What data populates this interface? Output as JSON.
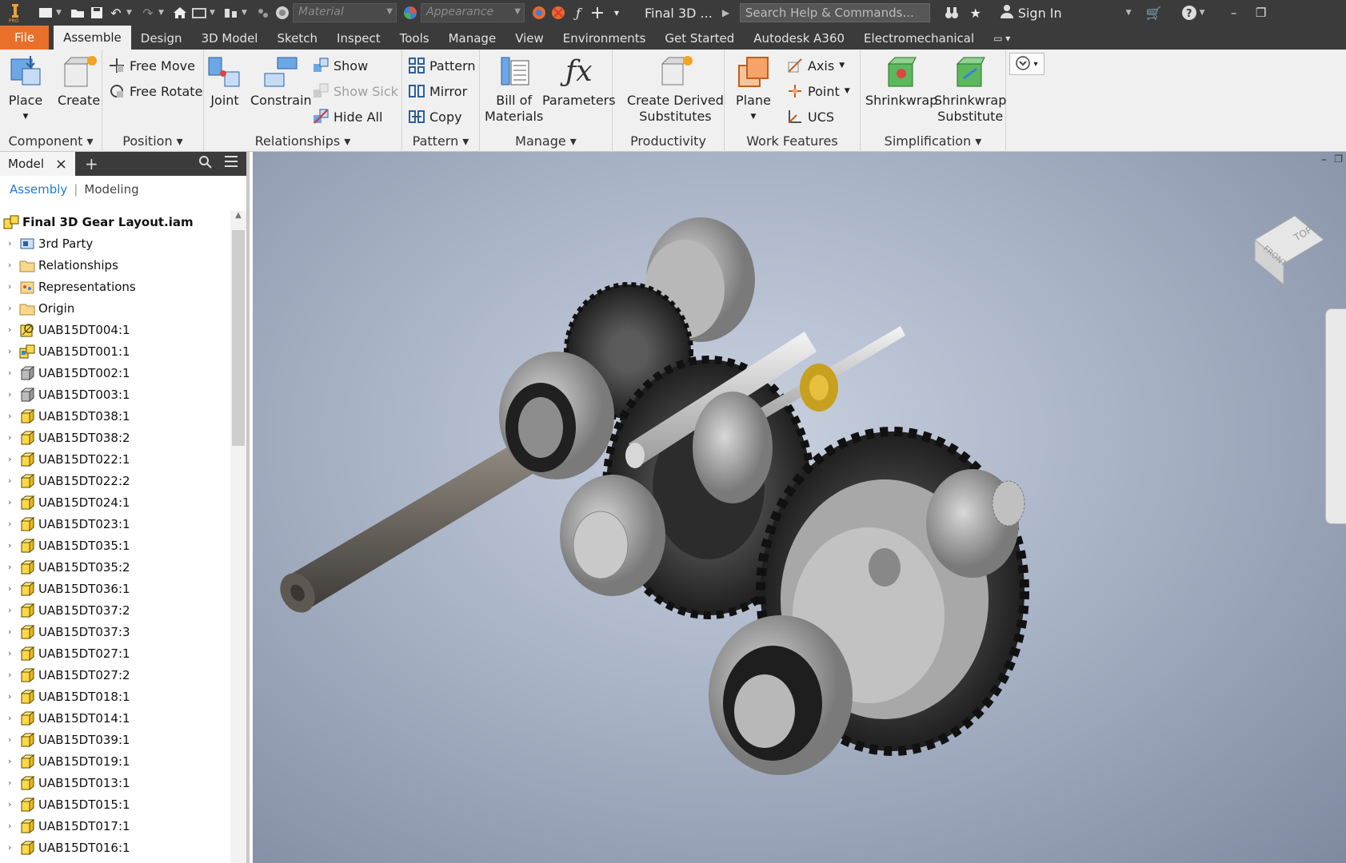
{
  "titlebar": {
    "material_placeholder": "Material",
    "appearance_placeholder": "Appearance",
    "doc_title": "Final 3D ...",
    "search_placeholder": "Search Help & Commands...",
    "sign_in": "Sign In"
  },
  "tabs": {
    "file": "File",
    "items": [
      "Assemble",
      "Design",
      "3D Model",
      "Sketch",
      "Inspect",
      "Tools",
      "Manage",
      "View",
      "Environments",
      "Get Started",
      "Autodesk A360",
      "Electromechanical"
    ],
    "active": "Assemble"
  },
  "ribbon": {
    "component": {
      "title": "Component",
      "place": "Place",
      "create": "Create"
    },
    "position": {
      "title": "Position",
      "free_move": "Free Move",
      "free_rotate": "Free Rotate"
    },
    "relationships": {
      "title": "Relationships",
      "joint": "Joint",
      "constrain": "Constrain",
      "show": "Show",
      "show_sick": "Show Sick",
      "hide_all": "Hide All"
    },
    "pattern": {
      "title": "Pattern",
      "pattern": "Pattern",
      "mirror": "Mirror",
      "copy": "Copy"
    },
    "manage": {
      "title": "Manage",
      "bom_line1": "Bill of",
      "bom_line2": "Materials",
      "parameters": "Parameters"
    },
    "productivity": {
      "title": "Productivity",
      "derived_line1": "Create Derived",
      "derived_line2": "Substitutes"
    },
    "work_features": {
      "title": "Work Features",
      "plane": "Plane",
      "axis": "Axis",
      "point": "Point",
      "ucs": "UCS"
    },
    "simplification": {
      "title": "Simplification",
      "shrinkwrap": "Shrinkwrap",
      "shrinkwrap_sub_line1": "Shrinkwrap",
      "shrinkwrap_sub_line2": "Substitute"
    }
  },
  "browser": {
    "tab_label": "Model",
    "mode_assembly": "Assembly",
    "mode_modeling": "Modeling",
    "root": "Final 3D Gear Layout.iam",
    "nodes": [
      {
        "label": "3rd Party",
        "icon": "third-party-icon"
      },
      {
        "label": "Relationships",
        "icon": "folder-icon"
      },
      {
        "label": "Representations",
        "icon": "representations-icon"
      },
      {
        "label": "Origin",
        "icon": "folder-icon"
      },
      {
        "label": "UAB15DT004:1",
        "icon": "flexible-assembly-icon"
      },
      {
        "label": "UAB15DT001:1",
        "icon": "subassembly-icon"
      },
      {
        "label": "UAB15DT002:1",
        "icon": "gray-part-icon"
      },
      {
        "label": "UAB15DT003:1",
        "icon": "gray-part-icon"
      },
      {
        "label": "UAB15DT038:1",
        "icon": "part-icon"
      },
      {
        "label": "UAB15DT038:2",
        "icon": "part-icon"
      },
      {
        "label": "UAB15DT022:1",
        "icon": "part-icon"
      },
      {
        "label": "UAB15DT022:2",
        "icon": "part-icon"
      },
      {
        "label": "UAB15DT024:1",
        "icon": "part-icon"
      },
      {
        "label": "UAB15DT023:1",
        "icon": "part-icon"
      },
      {
        "label": "UAB15DT035:1",
        "icon": "part-icon"
      },
      {
        "label": "UAB15DT035:2",
        "icon": "part-icon"
      },
      {
        "label": "UAB15DT036:1",
        "icon": "part-icon"
      },
      {
        "label": "UAB15DT037:2",
        "icon": "part-icon"
      },
      {
        "label": "UAB15DT037:3",
        "icon": "part-icon"
      },
      {
        "label": "UAB15DT027:1",
        "icon": "part-icon"
      },
      {
        "label": "UAB15DT027:2",
        "icon": "part-icon"
      },
      {
        "label": "UAB15DT018:1",
        "icon": "part-icon"
      },
      {
        "label": "UAB15DT014:1",
        "icon": "part-icon"
      },
      {
        "label": "UAB15DT039:1",
        "icon": "part-icon"
      },
      {
        "label": "UAB15DT019:1",
        "icon": "part-icon"
      },
      {
        "label": "UAB15DT013:1",
        "icon": "part-icon"
      },
      {
        "label": "UAB15DT015:1",
        "icon": "part-icon"
      },
      {
        "label": "UAB15DT017:1",
        "icon": "part-icon"
      },
      {
        "label": "UAB15DT016:1",
        "icon": "part-icon"
      }
    ]
  },
  "viewcube": {
    "top": "TOP",
    "front": "FRONT"
  },
  "colors": {
    "accent": "#e8702a",
    "link": "#1f7bd1",
    "titlebar": "#3b3b3b",
    "ribbon": "#f0f0f0"
  }
}
